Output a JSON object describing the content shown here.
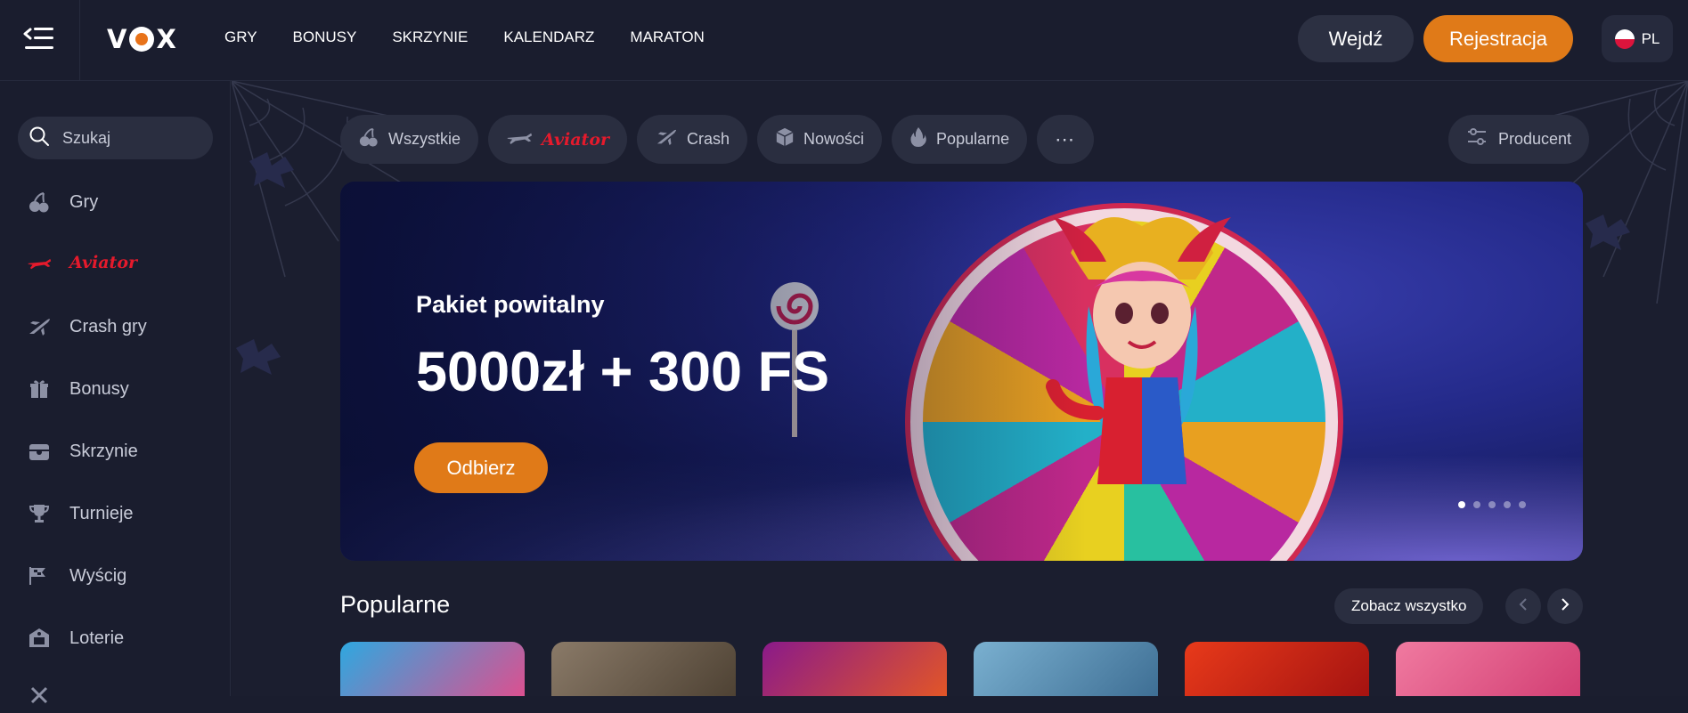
{
  "header": {
    "logo_text": "VOX",
    "nav": [
      "GRY",
      "BONUSY",
      "SKRZYNIE",
      "KALENDARZ",
      "MARATON"
    ],
    "login_label": "Wejdź",
    "register_label": "Rejestracja",
    "language": "PL"
  },
  "sidebar": {
    "search_placeholder": "Szukaj",
    "items": [
      {
        "label": "Gry",
        "icon": "cherries-icon"
      },
      {
        "label": "Aviator",
        "icon": "plane-icon"
      },
      {
        "label": "Crash gry",
        "icon": "jet-icon"
      },
      {
        "label": "Bonusy",
        "icon": "gift-icon"
      },
      {
        "label": "Skrzynie",
        "icon": "chest-icon"
      },
      {
        "label": "Turnieje",
        "icon": "trophy-icon"
      },
      {
        "label": "Wyścig",
        "icon": "flags-icon"
      },
      {
        "label": "Loterie",
        "icon": "lottery-icon"
      }
    ]
  },
  "categories": [
    {
      "label": "Wszystkie",
      "icon": "cherries-icon"
    },
    {
      "label": "Aviator",
      "icon": "plane-icon"
    },
    {
      "label": "Crash",
      "icon": "jet-icon"
    },
    {
      "label": "Nowości",
      "icon": "cube-icon"
    },
    {
      "label": "Popularne",
      "icon": "flame-icon"
    }
  ],
  "producer_label": "Producent",
  "banner": {
    "subtitle": "Pakiet powitalny",
    "title": "5000zł + 300 FS",
    "cta": "Odbierz",
    "slides": 5,
    "active_slide": 1
  },
  "popular": {
    "title": "Popularne",
    "see_all": "Zobacz wszystko",
    "thumb_colors": [
      "#2ea8e0",
      "#6a5a48",
      "#c0202a",
      "#5a8ab0",
      "#d02a1a",
      "#e85a8a"
    ]
  },
  "colors": {
    "accent": "#e07a18",
    "aviator_red": "#e51a2c",
    "bg": "#1a1d2e",
    "chip_bg": "#2a2e40"
  }
}
